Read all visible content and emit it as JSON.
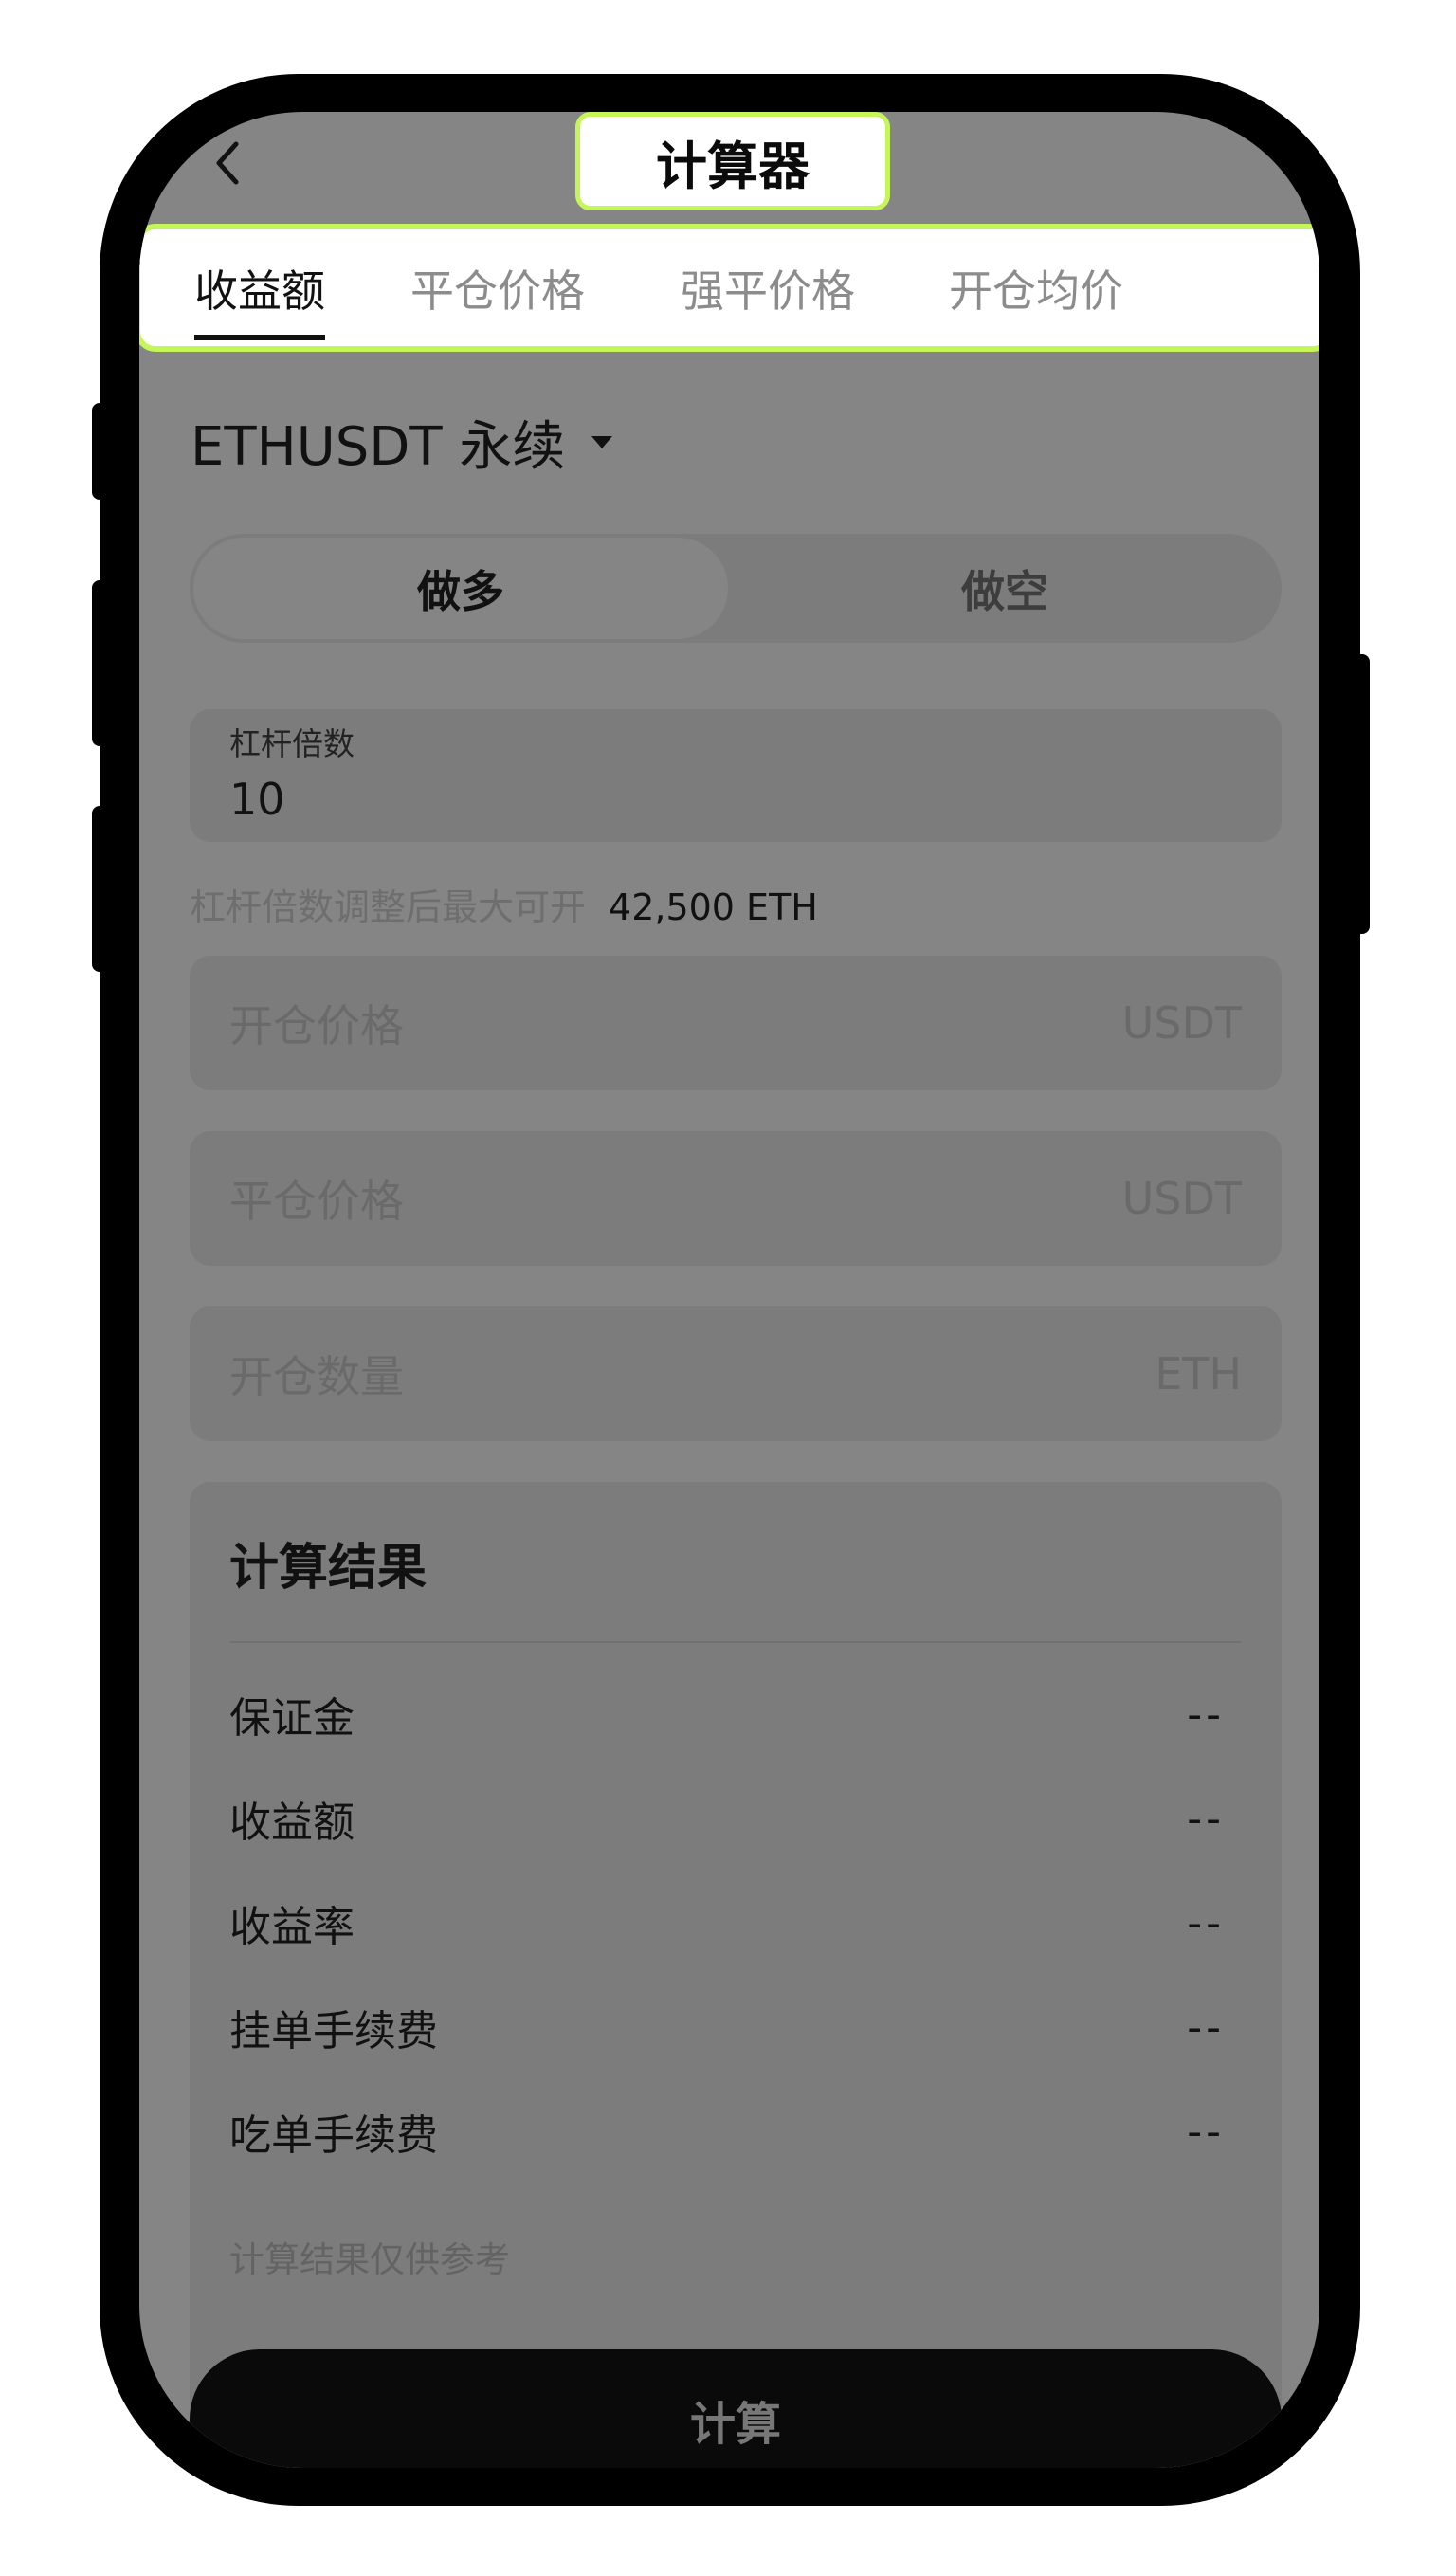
{
  "header": {
    "title": "计算器",
    "back_icon": "chevron-left-icon"
  },
  "tabs": [
    {
      "label": "收益额",
      "active": true
    },
    {
      "label": "平仓价格",
      "active": false
    },
    {
      "label": "强平价格",
      "active": false
    },
    {
      "label": "开仓均价",
      "active": false
    }
  ],
  "symbol": {
    "label": "ETHUSDT 永续",
    "dropdown_icon": "caret-down-icon"
  },
  "direction": {
    "long_label": "做多",
    "short_label": "做空",
    "selected": "long"
  },
  "leverage": {
    "label": "杠杆倍数",
    "value": "10",
    "max_open_label": "杠杆倍数调整后最大可开",
    "max_open_value": "42,500 ETH"
  },
  "fields": [
    {
      "placeholder": "开仓价格",
      "unit": "USDT"
    },
    {
      "placeholder": "平仓价格",
      "unit": "USDT"
    },
    {
      "placeholder": "开仓数量",
      "unit": "ETH"
    }
  ],
  "result": {
    "title": "计算结果",
    "rows": [
      {
        "label": "保证金",
        "value": "--"
      },
      {
        "label": "收益额",
        "value": "--"
      },
      {
        "label": "收益率",
        "value": "--"
      },
      {
        "label": "挂单手续费",
        "value": "--"
      },
      {
        "label": "吃单手续费",
        "value": "--"
      }
    ],
    "disclaimer": "计算结果仅供参考"
  },
  "calculate_button": {
    "label": "计算"
  },
  "colors": {
    "highlight": "#c6f55a",
    "overlay": "#858585",
    "button": "#0a0a0a"
  }
}
